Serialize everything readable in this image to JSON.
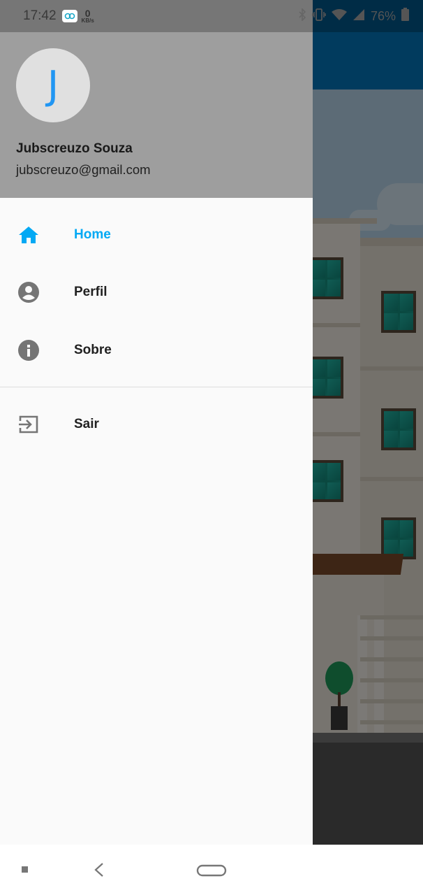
{
  "status_bar": {
    "time": "17:42",
    "speed_value": "0",
    "speed_unit": "KB/s",
    "battery": "76%",
    "icons": [
      "app-icon",
      "bluetooth-icon",
      "vibrate-icon",
      "wifi-icon",
      "signal-icon",
      "battery-icon"
    ]
  },
  "drawer": {
    "avatar_initial": "J",
    "user_name": "Jubscreuzo Souza",
    "user_email": "jubscreuzo@gmail.com",
    "items": [
      {
        "label": "Home",
        "icon": "home-icon",
        "active": true
      },
      {
        "label": "Perfil",
        "icon": "account-circle-icon",
        "active": false
      },
      {
        "label": "Sobre",
        "icon": "info-icon",
        "active": false
      }
    ],
    "footer_items": [
      {
        "label": "Sair",
        "icon": "exit-icon"
      }
    ]
  },
  "nav_bar": {
    "icons": [
      "recents-icon",
      "back-icon",
      "home-pill-icon"
    ]
  },
  "colors": {
    "accent": "#03a9f4",
    "header_bg": "#9e9e9e",
    "avatar_bg": "#e0e0e0",
    "avatar_text": "#2196f3",
    "drawer_bg": "#fafafa",
    "icon_gray": "#757575",
    "app_bar": "#0277bd"
  }
}
